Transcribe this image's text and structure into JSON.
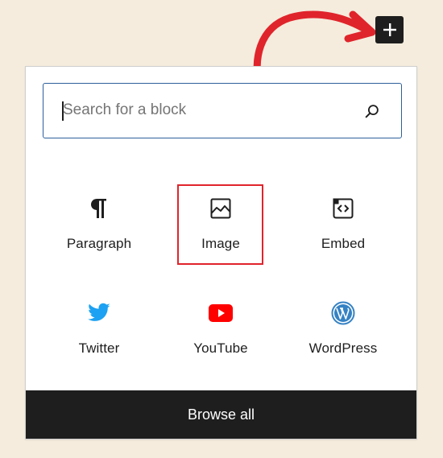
{
  "search": {
    "placeholder": "Search for a block"
  },
  "blocks": [
    {
      "label": "Paragraph",
      "icon": "paragraph-icon"
    },
    {
      "label": "Image",
      "icon": "image-icon"
    },
    {
      "label": "Embed",
      "icon": "embed-icon"
    },
    {
      "label": "Twitter",
      "icon": "twitter-icon"
    },
    {
      "label": "YouTube",
      "icon": "youtube-icon"
    },
    {
      "label": "WordPress",
      "icon": "wordpress-icon"
    }
  ],
  "footer": {
    "browse_all_label": "Browse all"
  },
  "colors": {
    "background": "#f5ecdd",
    "dark": "#1e1e1e",
    "search_border": "#2d5f9a",
    "highlight": "#e0242b",
    "twitter": "#1da1f2",
    "youtube": "#ff0000",
    "wordpress": "#3582c4"
  }
}
